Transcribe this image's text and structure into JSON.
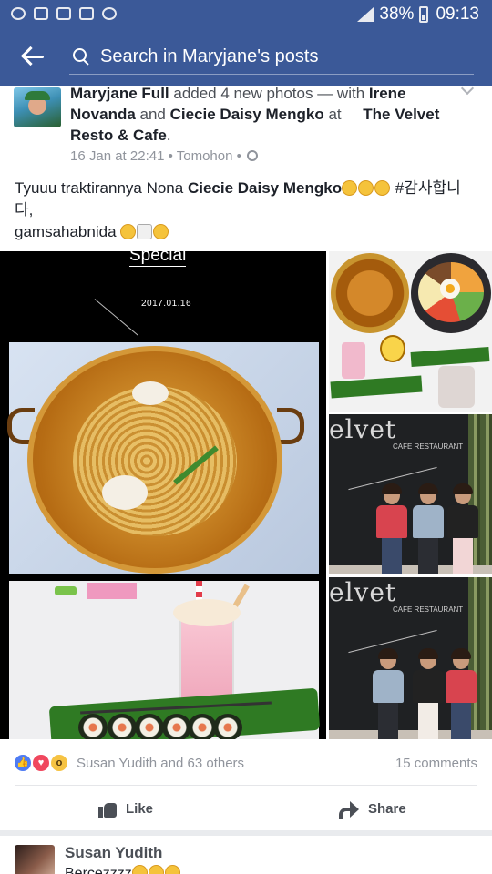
{
  "status_bar": {
    "left_icons": [
      "line-icon",
      "gallery-icon",
      "camera-icon",
      "mail-icon",
      "messenger-icon"
    ],
    "battery": "38%",
    "time": "09:13"
  },
  "header": {
    "search_placeholder": "Search in Maryjane's posts",
    "color": "#3b5998"
  },
  "post": {
    "author": "Maryjane Full",
    "action": " added 4 new photos — with ",
    "tag1": "Irene Novanda",
    "and": " and ",
    "tag2": "Ciecie Daisy Mengko",
    "at": " at ",
    "place": "The Velvet Resto & Cafe",
    "period": ".",
    "date": "16 Jan at 22:41",
    "sep": " • ",
    "location": "Tomohon",
    "sep2": " •",
    "text_part1": "Tyuuu traktirannya Nona ",
    "text_mention": "Ciecie Daisy Mengko",
    "text_part2": " #감사합니다,",
    "text_line2": "gamsahabnida",
    "photo": {
      "title": "Special",
      "date": "2017.01.16",
      "wall_text": "elvet",
      "wall_sub": "CAFE RESTAURANT"
    }
  },
  "reactions": {
    "icons": [
      "like-icon",
      "love-icon",
      "wow-icon"
    ],
    "names": "Susan Yudith and 63 others",
    "comments": "15 comments"
  },
  "actions": {
    "like": "Like",
    "share": "Share"
  },
  "comment_preview": {
    "name": "Susan Yudith",
    "text": "Bercezzzz"
  }
}
